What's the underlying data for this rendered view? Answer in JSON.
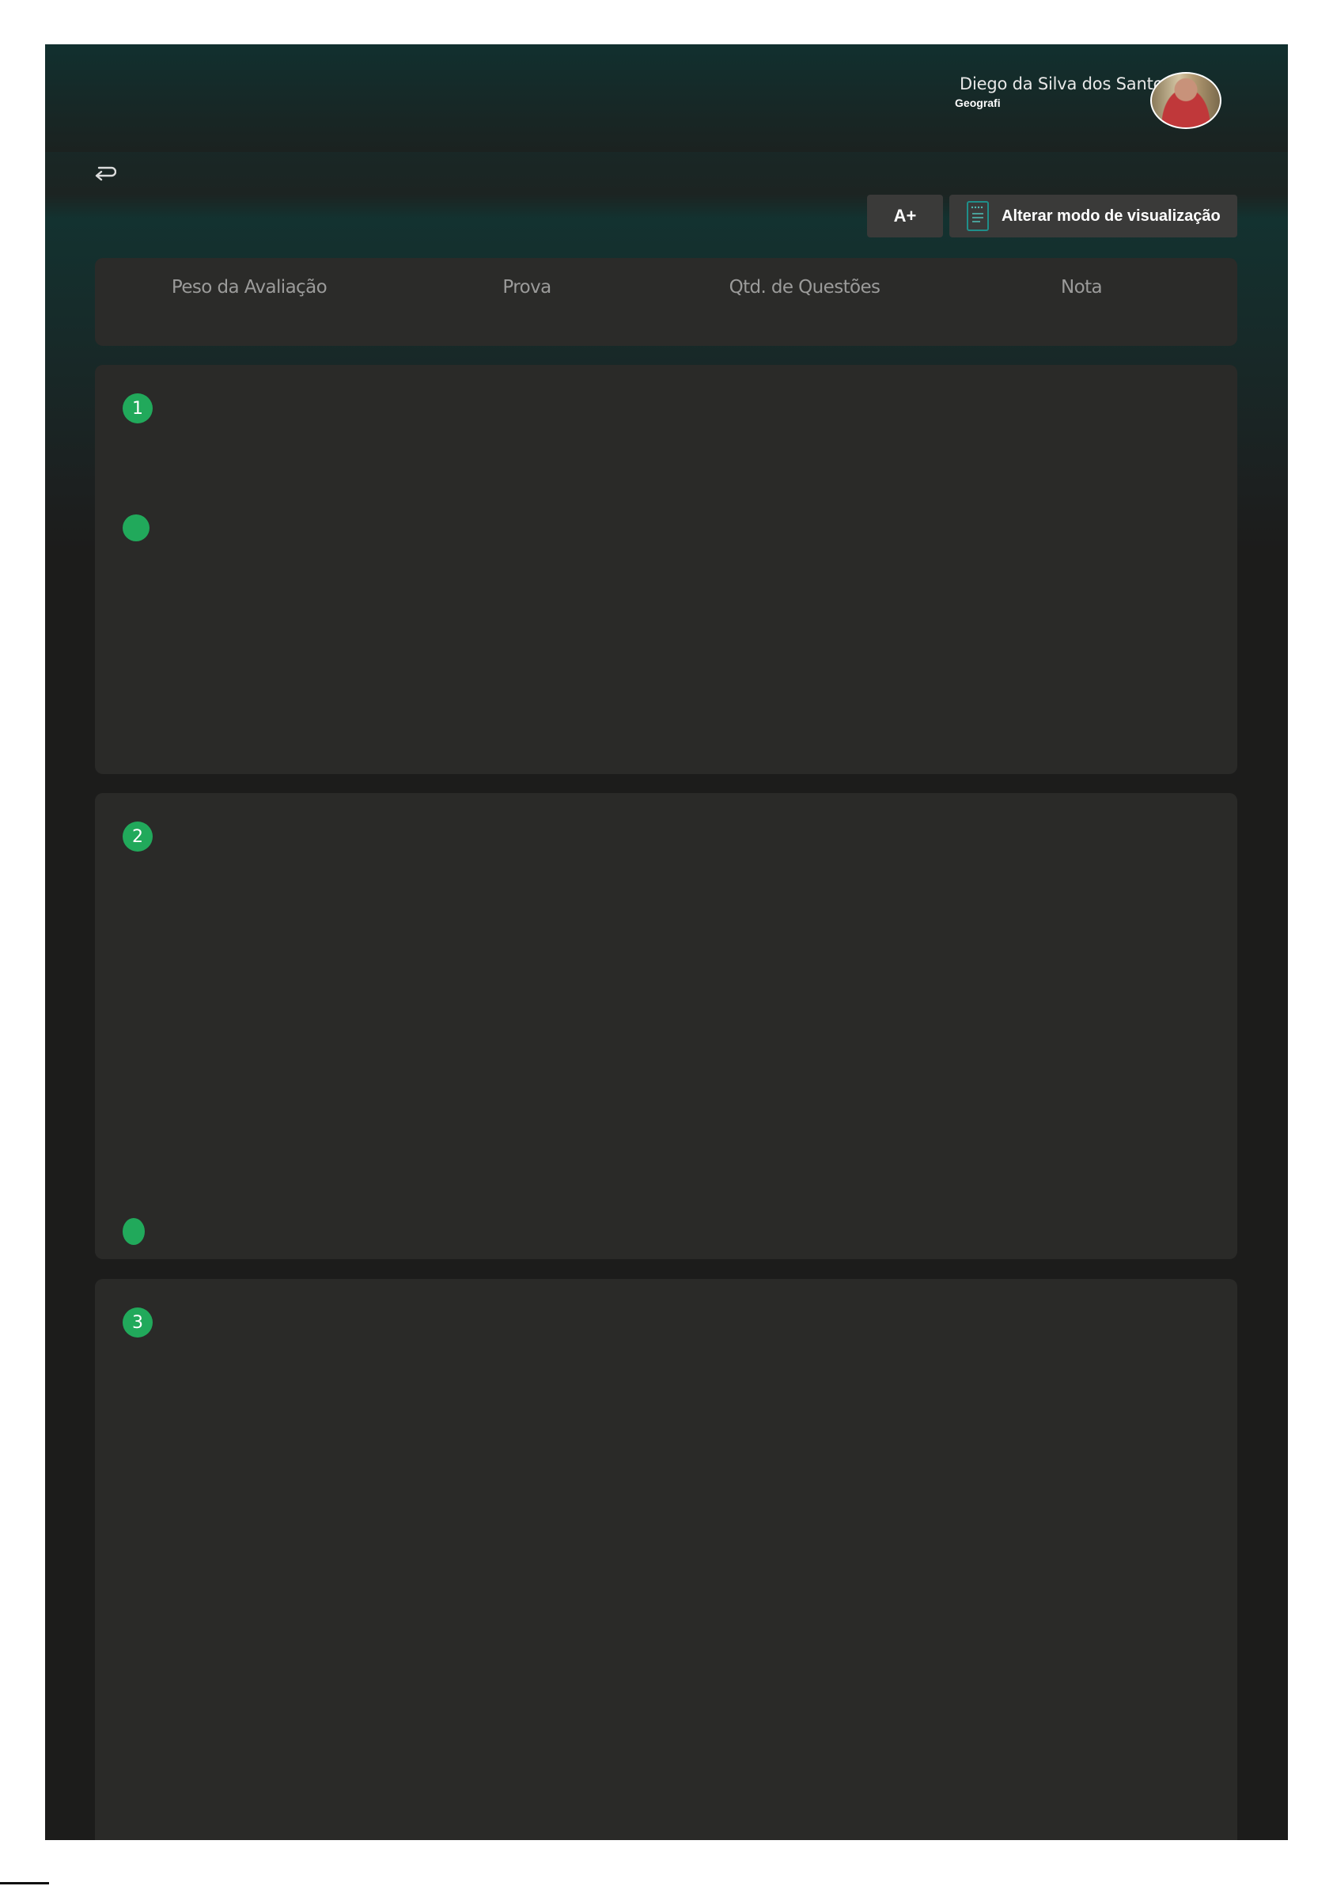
{
  "user": {
    "name": "Diego da Silva dos Santos",
    "subject": "Geografi"
  },
  "toolbar": {
    "font_size_label": "A+",
    "view_mode_label": "Alterar modo de visualização"
  },
  "table_header": {
    "columns": [
      "Peso da Avaliação",
      "Prova",
      "Qtd. de Questões",
      "Nota"
    ]
  },
  "questions": [
    {
      "number": "1"
    },
    {
      "number": "2"
    },
    {
      "number": "3"
    }
  ],
  "colors": {
    "accent": "#21a95b",
    "card": "#2a2a28",
    "header_gradient_top": "#11302f",
    "background": "#1c1c1b"
  }
}
